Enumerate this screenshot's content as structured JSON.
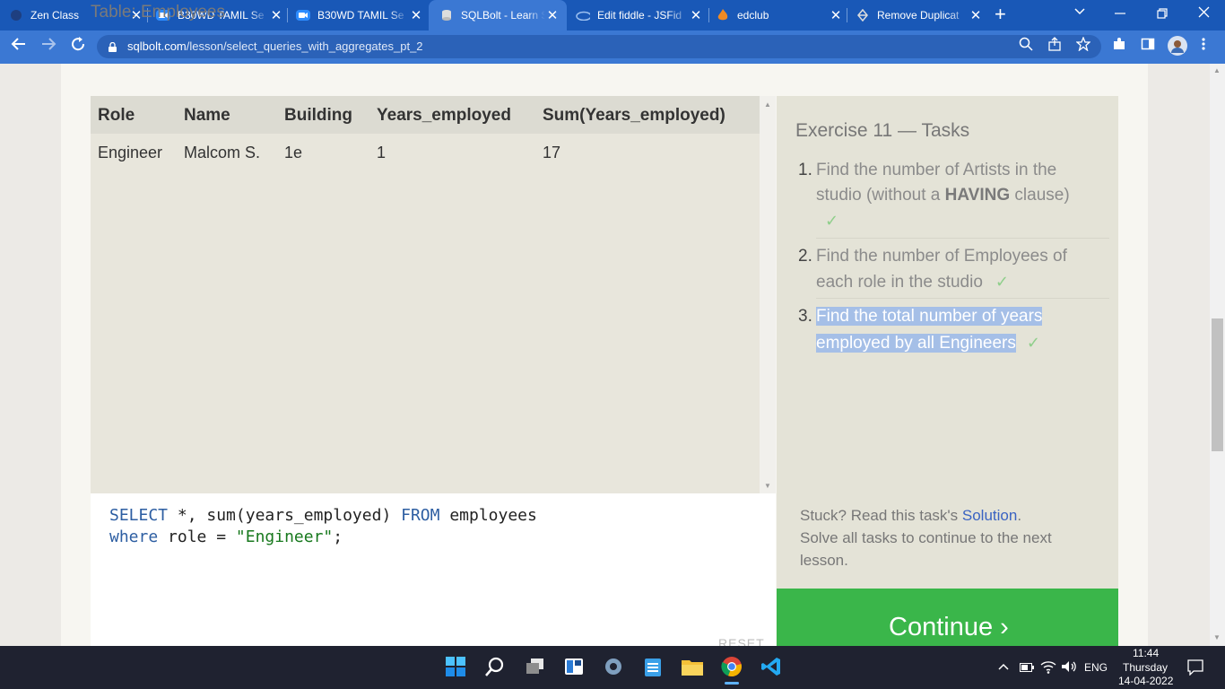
{
  "browser": {
    "tabs": [
      {
        "title": "Zen Class"
      },
      {
        "title": "B30WD TAMIL Se"
      },
      {
        "title": "B30WD TAMIL Se"
      },
      {
        "title": "SQLBolt - Learn S"
      },
      {
        "title": "Edit fiddle - JSFid"
      },
      {
        "title": "edclub"
      },
      {
        "title": "Remove Duplicat"
      }
    ],
    "close_glyph": "✕",
    "new_tab_glyph": "+",
    "url_host": "sqlbolt.com",
    "url_path": "/lesson/select_queries_with_aggregates_pt_2",
    "accent": "#1958b7"
  },
  "lesson": {
    "table_title": "Table: Employees",
    "columns": [
      "Role",
      "Name",
      "Building",
      "Years_employed",
      "Sum(Years_employed)"
    ],
    "rows": [
      [
        "Engineer",
        "Malcom S.",
        "1e",
        "1",
        "17"
      ]
    ],
    "query_line1": {
      "select": "SELECT",
      "rest1": " *, sum(years_employed) ",
      "from": "FROM",
      "rest2": " employees"
    },
    "query_line2": {
      "where": "where",
      "rest": " role = ",
      "string": "\"Engineer\"",
      "end": ";"
    },
    "reset_label": "RESET"
  },
  "exercise": {
    "heading": "Exercise 11 — Tasks",
    "tasks": [
      {
        "num": "1.",
        "line1": "Find the number of Artists in the",
        "line2a": "studio (without a ",
        "line2b": "HAVING",
        "line2c": " clause)",
        "check": "✓"
      },
      {
        "num": "2.",
        "line1": "Find the number of Employees of",
        "line2": "each role in the studio",
        "check": "✓"
      },
      {
        "num": "3.",
        "line1": "Find the total number of years",
        "line2": "employed by all Engineers",
        "check": "✓"
      }
    ],
    "stuck_prefix": "Stuck? Read this task's ",
    "solution_link": "Solution",
    "stuck_suffix": ".",
    "solve_line1": "Solve all tasks to continue to the next",
    "solve_line2": "lesson.",
    "continue_label": "Continue ›",
    "continue_color": "#3ab64a"
  },
  "taskbar": {
    "lang": "ENG",
    "time": "11:44",
    "day": "Thursday",
    "date": "14-04-2022"
  }
}
